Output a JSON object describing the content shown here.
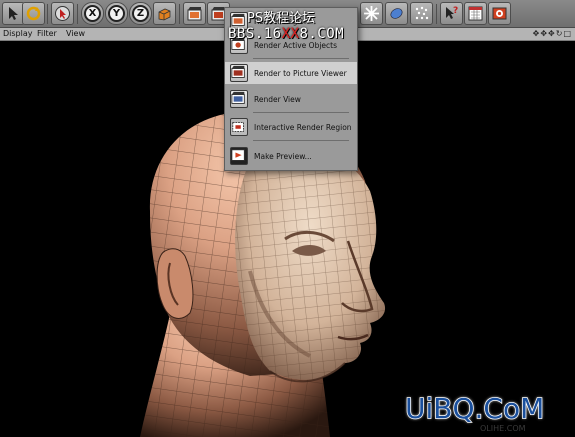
{
  "toolbar": {
    "icons": [
      "cursor-icon",
      "rotate-icon",
      "select-arrow-icon",
      "x-axis-icon",
      "y-axis-icon",
      "z-axis-icon",
      "coordinate-system-icon",
      "render-view-icon",
      "render-picture-viewer-icon",
      "grid-icon",
      "scale-icon",
      "sphere-icon",
      "particles-icon",
      "help-cursor-icon",
      "material-icon",
      "camera-icon"
    ],
    "axis_x": "X",
    "axis_y": "Y",
    "axis_z": "Z"
  },
  "menubar": {
    "items": [
      "Display",
      "Filter",
      "View"
    ]
  },
  "render_menu": {
    "items": [
      {
        "label": "Render Region",
        "icon": "render-region-icon"
      },
      {
        "label": "Render Active Objects",
        "icon": "render-active-objects-icon"
      },
      {
        "label": "Render to Picture Viewer",
        "icon": "render-to-picture-viewer-icon",
        "selected": true
      },
      {
        "label": "Render View",
        "icon": "render-view-icon"
      },
      {
        "label": "Interactive Render Region",
        "icon": "interactive-render-region-icon"
      },
      {
        "label": "Make Preview...",
        "icon": "make-preview-icon"
      }
    ]
  },
  "watermarks": {
    "title": "PS教程论坛",
    "url_prefix": "BBS.16",
    "url_red": "XX",
    "url_suffix": "8.COM",
    "brand": "UiBQ.CoM",
    "brand_sub": "OLIHE.COM"
  },
  "colors": {
    "toolbar_bg": "#7d7d7d",
    "menu_bg": "#9a9a9a",
    "menu_selected": "#d0d0d0",
    "skin": "#d49a7c",
    "viewport_bg": "#000000",
    "brand_blue": "#1a4f9c"
  }
}
